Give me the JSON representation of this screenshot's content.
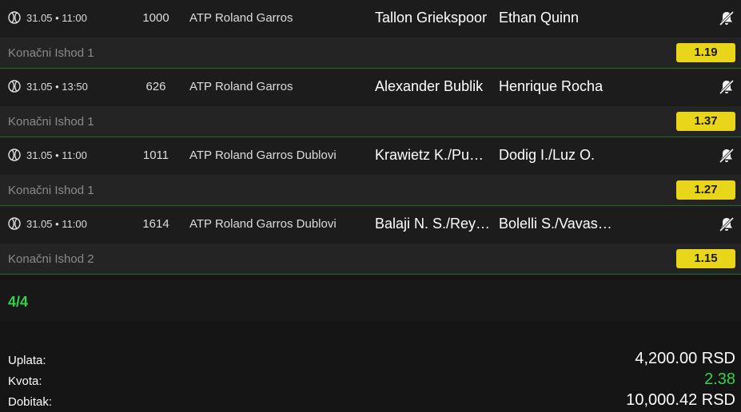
{
  "matches": [
    {
      "datetime": "31.05 • 11:00",
      "code": "1000",
      "league": "ATP Roland Garros",
      "home": "Tallon Griekspoor",
      "away": "Ethan Quinn",
      "outcome": "Konačni Ishod 1",
      "odds": "1.19",
      "sport_icon": "tennis-ball-icon",
      "bell_icon": "bell-off-icon"
    },
    {
      "datetime": "31.05 • 13:50",
      "code": "626",
      "league": "ATP Roland Garros",
      "home": "Alexander Bublik",
      "away": "Henrique Rocha",
      "outcome": "Konačni Ishod 1",
      "odds": "1.37",
      "sport_icon": "tennis-ball-icon",
      "bell_icon": "bell-off-icon"
    },
    {
      "datetime": "31.05 • 11:00",
      "code": "1011",
      "league": "ATP Roland Garros Dublovi",
      "home": "Krawietz K./Puetz T.",
      "away": "Dodig I./Luz O.",
      "outcome": "Konačni Ishod 1",
      "odds": "1.27",
      "sport_icon": "tennis-ball-icon",
      "bell_icon": "bell-off-icon"
    },
    {
      "datetime": "31.05 • 11:00",
      "code": "1614",
      "league": "ATP Roland Garros Dublovi",
      "home": "Balaji N. S./Reyes-Varela M.",
      "away": "Bolelli S./Vavassori A.",
      "outcome": "Konačni Ishod 2",
      "odds": "1.15",
      "sport_icon": "tennis-ball-icon",
      "bell_icon": "bell-off-icon"
    }
  ],
  "counter": "4/4",
  "summary": {
    "stake_label": "Uplata:",
    "stake_value": "4,200.00 RSD",
    "odds_label": "Kvota:",
    "odds_value": "2.38",
    "win_label": "Dobitak:",
    "win_value": "10,000.42 RSD"
  },
  "colors": {
    "odds_badge": "#e9d61a",
    "accent_green": "#33d24a",
    "row_bg": "#1c1c1c",
    "outcome_bg": "#242424"
  }
}
